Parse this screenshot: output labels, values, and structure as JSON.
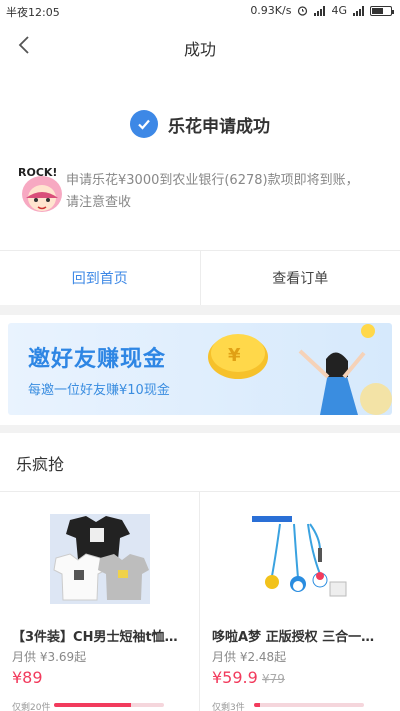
{
  "status_bar": {
    "time": "半夜12:05",
    "speed": "0.93K/s",
    "network": "4G"
  },
  "nav": {
    "title": "成功"
  },
  "result": {
    "title": "乐花申请成功",
    "description": "申请乐花¥3000到农业银行(6278)款项即将到账，请注意查收",
    "sticker_text": "ROCK!"
  },
  "actions": {
    "home_label": "回到首页",
    "order_label": "查看订单"
  },
  "banner": {
    "title": "邀好友赚现金",
    "subtitle": "每邀一位好友赚¥10现金"
  },
  "deals": {
    "section_title": "乐疯抢",
    "products": [
      {
        "name": "【3件装】CH男士短袖t恤…",
        "monthly": "月供 ¥3.69起",
        "price": "¥89",
        "original_price": "",
        "stock": "仅剩20件",
        "stock_ratio": 0.7
      },
      {
        "name": "哆啦A梦 正版授权 三合一…",
        "monthly": "月供 ¥2.48起",
        "price": "¥59.9",
        "original_price": "¥79",
        "stock": "仅剩3件",
        "stock_ratio": 0.05
      }
    ]
  },
  "colors": {
    "accent": "#3d88e6",
    "price": "#f23b5d"
  }
}
